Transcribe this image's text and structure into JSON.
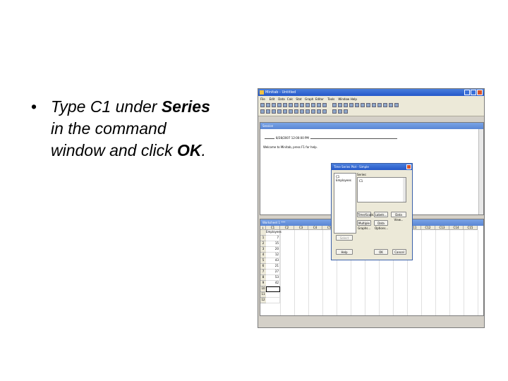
{
  "slide": {
    "bullet": "•",
    "line1_pre": "Type C1 under ",
    "line1_bold": "Series",
    "line2": "in the command",
    "line3_pre": "window and click ",
    "line3_bold": "OK",
    "line3_post": "."
  },
  "app": {
    "title": "Minitab - Untitled",
    "menu": [
      "File",
      "Edit",
      "Data",
      "Calc",
      "Stat",
      "Graph",
      "Editor",
      "Tools",
      "Window",
      "Help"
    ]
  },
  "session": {
    "title": "Session",
    "clock_text": "8/28/2007 12:00:00 PM",
    "welcome": "Welcome to Minitab, press F1 for help."
  },
  "worksheet": {
    "title": "Worksheet 1 ***",
    "columns": [
      "↓",
      "C1",
      "C2",
      "C3",
      "C4",
      "C5",
      "C6",
      "C7",
      "C8",
      "C9",
      "C10",
      "C11",
      "C12",
      "C13",
      "C14",
      "C15"
    ],
    "column_name": "Employees",
    "rows": [
      "1",
      "2",
      "3",
      "4",
      "5",
      "6",
      "7",
      "8",
      "9",
      "10",
      "11",
      "12"
    ],
    "values": [
      "7",
      "15",
      "20",
      "12",
      "43",
      "21",
      "27",
      "53",
      "42",
      "",
      "",
      ""
    ]
  },
  "dialog": {
    "title": "Time Series Plot - Simple",
    "var_item": "C1   Employees",
    "series_label": "Series:",
    "series_value": "C1",
    "buttons": {
      "time_scale": "Time/Scale...",
      "labels": "Labels...",
      "data_view": "Data View...",
      "multiple_graphs": "Multiple Graphs...",
      "data_options": "Data Options...",
      "select": "Select",
      "help": "Help",
      "ok": "OK",
      "cancel": "Cancel"
    }
  },
  "colors": {
    "titlebar": "#2457c9",
    "window_bg": "#d4d0c8",
    "close": "#d8532a"
  }
}
